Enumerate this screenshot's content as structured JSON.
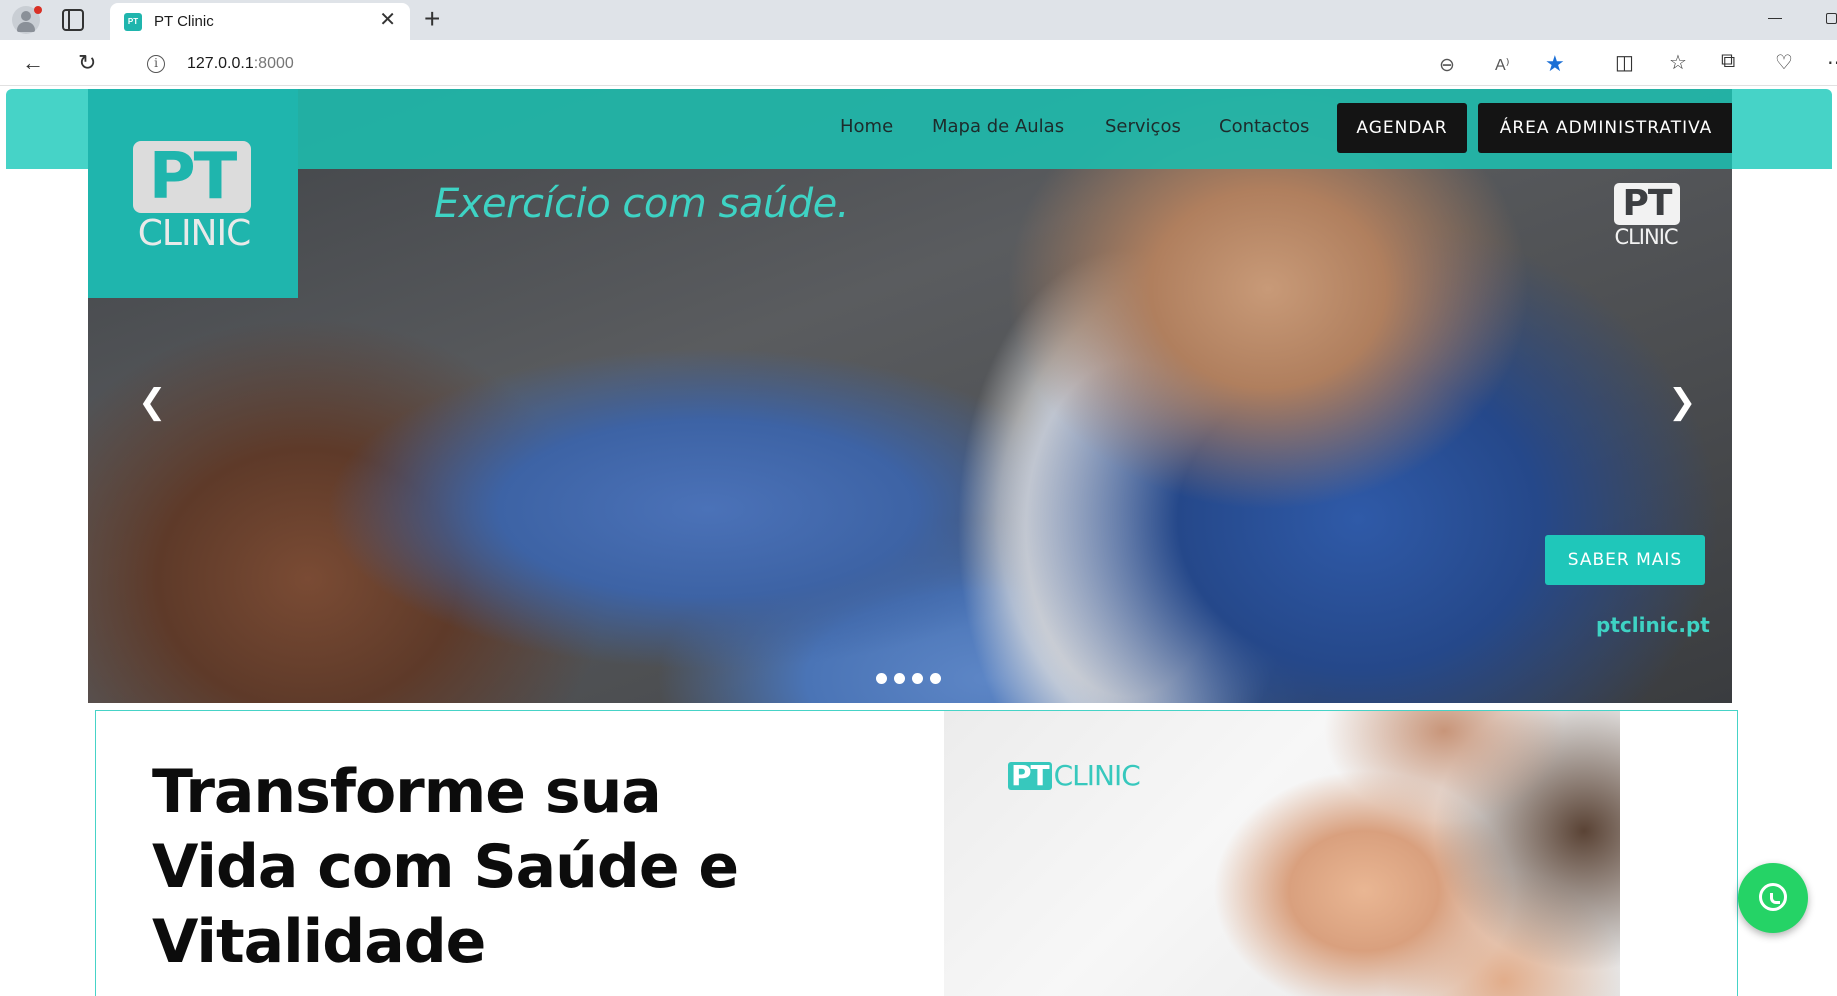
{
  "browser": {
    "tab_title": "PT Clinic",
    "tab_favicon_text": "PT",
    "close_tab_glyph": "✕",
    "new_tab_glyph": "+",
    "url_host": "127.0.0.1",
    "url_port": ":8000",
    "info_glyph": "i",
    "icons": [
      "back-arrow-icon",
      "reload-icon",
      "zoom-out-icon",
      "read-aloud-icon",
      "favorite-star-icon",
      "split-screen-icon",
      "favorites-icon",
      "collections-icon",
      "browser-essentials-icon",
      "more-icon"
    ],
    "glyphs": {
      "back": "←",
      "reload": "↻",
      "zoom_out": "⊖",
      "read_aloud": "A⁾",
      "star": "★",
      "split": "◫",
      "favorites": "☆",
      "collections": "⧉",
      "essentials": "♡",
      "more": "⋯"
    }
  },
  "site": {
    "logo": {
      "pt": "PT",
      "clinic": "CLINIC"
    },
    "nav": [
      {
        "label": "Home"
      },
      {
        "label": "Mapa de Aulas"
      },
      {
        "label": "Serviços"
      },
      {
        "label": "Contactos"
      }
    ],
    "buttons": {
      "agendar": "AGENDAR",
      "admin": "ÁREA ADMINISTRATIVA"
    },
    "hero": {
      "tagline": "Exercício com saúde.",
      "mini_logo": {
        "pt": "PT",
        "clinic": "CLINIC"
      },
      "cta": "SABER MAIS",
      "url": "ptclinic.pt",
      "prev_glyph": "❮",
      "next_glyph": "❯",
      "slides_count": 4
    },
    "about": {
      "title_lines": [
        "Transforme sua",
        "Vida com Saúde e",
        "Vitalidade"
      ],
      "image_logo": {
        "pt": "PT",
        "clinic": "CLINIC"
      }
    },
    "colors": {
      "accent": "#1fb5ad",
      "accent_light": "#46d3c7",
      "dark_button": "#141414",
      "whatsapp": "#25d366"
    }
  }
}
